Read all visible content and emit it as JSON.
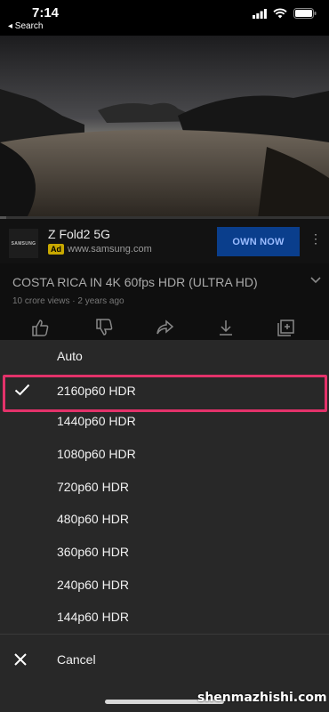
{
  "status_bar": {
    "time": "7:14",
    "back_label": "◂ Search"
  },
  "video": {
    "progress_fraction": 0.02
  },
  "ad": {
    "logo_text": "SAMSUNG",
    "title": "Z Fold2 5G",
    "tag": "Ad",
    "url": "www.samsung.com",
    "cta": "OWN NOW",
    "more": "⋮"
  },
  "info": {
    "title": "COSTA RICA IN 4K 60fps HDR (ULTRA HD)",
    "meta": "10 crore views · 2 years ago"
  },
  "quality": {
    "options": [
      {
        "label": "Auto",
        "selected": false
      },
      {
        "label": "2160p60 HDR",
        "selected": true
      },
      {
        "label": "1440p60 HDR",
        "selected": false
      },
      {
        "label": "1080p60 HDR",
        "selected": false
      },
      {
        "label": "720p60 HDR",
        "selected": false
      },
      {
        "label": "480p60 HDR",
        "selected": false
      },
      {
        "label": "360p60 HDR",
        "selected": false
      },
      {
        "label": "240p60 HDR",
        "selected": false
      },
      {
        "label": "144p60 HDR",
        "selected": false
      }
    ],
    "cancel": "Cancel"
  },
  "watermark": "shenmazhishi.com",
  "colors": {
    "highlight": "#e3326a",
    "sheet": "#282828",
    "ad_cta": "#0a3e8c"
  }
}
